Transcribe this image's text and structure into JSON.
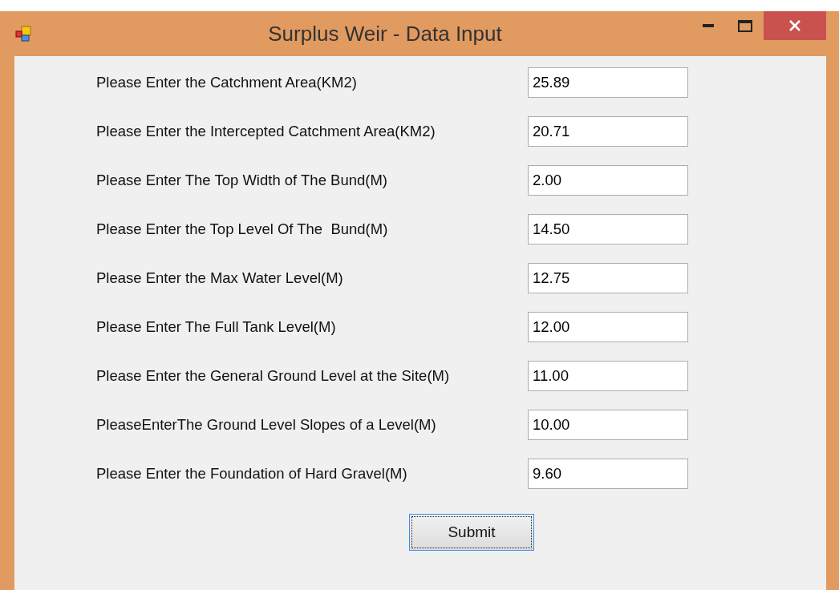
{
  "window": {
    "title": "Surplus Weir - Data Input"
  },
  "fields": [
    {
      "label": "Please Enter the Catchment Area(KM2)",
      "value": "25.89"
    },
    {
      "label": "Please Enter the Intercepted Catchment Area(KM2)",
      "value": "20.71"
    },
    {
      "label": "Please Enter The Top Width of The Bund(M)",
      "value": "2.00"
    },
    {
      "label": "Please Enter the Top Level Of The  Bund(M)",
      "value": "14.50"
    },
    {
      "label": "Please Enter the Max Water Level(M)",
      "value": "12.75"
    },
    {
      "label": "Please Enter The Full Tank Level(M)",
      "value": "12.00"
    },
    {
      "label": "Please Enter the General Ground Level at the Site(M)",
      "value": "11.00"
    },
    {
      "label": "PleaseEnterThe Ground Level Slopes of a Level(M)",
      "value": "10.00"
    },
    {
      "label": "Please Enter the Foundation of Hard Gravel(M)",
      "value": "9.60"
    }
  ],
  "submit": {
    "label": "Submit"
  }
}
